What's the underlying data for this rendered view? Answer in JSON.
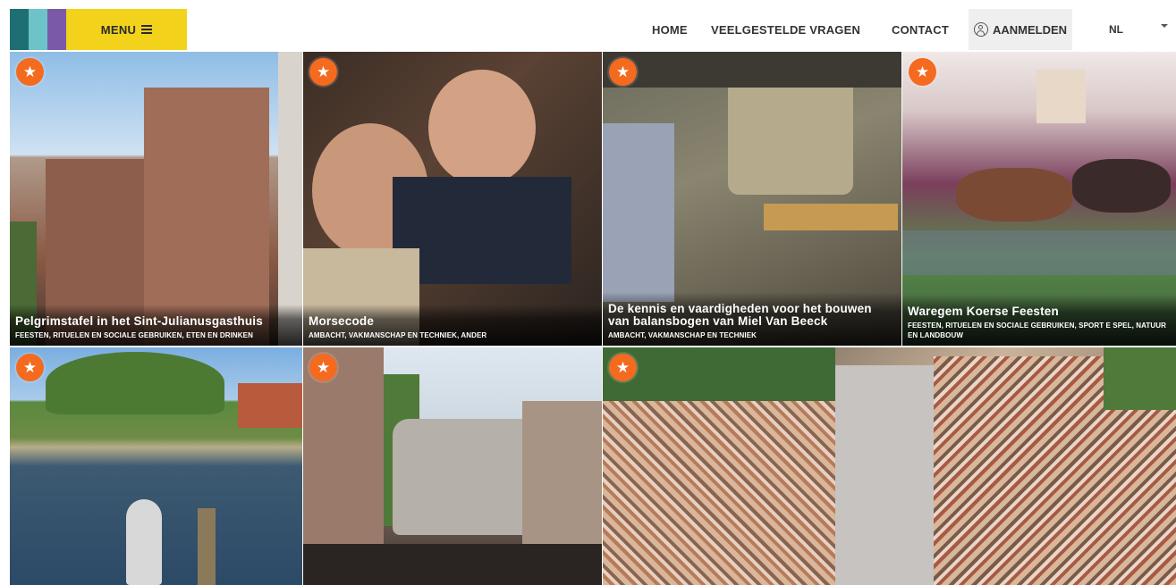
{
  "header": {
    "brand_colors": [
      "#1e6f74",
      "#6cc4c8",
      "#7a5aa8"
    ],
    "menu_label": "MENU",
    "menu_bg": "#f2d21b",
    "nav": [
      "HOME",
      "VEELGESTELDE VRAGEN",
      "CONTACT"
    ],
    "login_label": "AANMELDEN",
    "language": "NL",
    "icons": {
      "menu": "hamburger-icon",
      "login": "user-icon",
      "language": "chevron-down-icon"
    }
  },
  "accent_color": "#f46a1f",
  "tiles": [
    {
      "title": "Pelgrimstafel in het Sint-Julianusgasthuis",
      "categories": "FEESTEN, RITUELEN EN SOCIALE GEBRUIKEN, ETEN EN DRINKEN"
    },
    {
      "title": "Morsecode",
      "categories": "AMBACHT, VAKMANSCHAP EN TECHNIEK, ANDER"
    },
    {
      "title": "De kennis en vaardigheden voor het bouwen van balansbogen van Miel Van Beeck",
      "categories": "AMBACHT, VAKMANSCHAP EN TECHNIEK"
    },
    {
      "title": "Waregem Koerse Feesten",
      "categories": "FEESTEN, RITUELEN EN SOCIALE GEBRUIKEN, SPORT E SPEL, NATUUR EN LANDBOUW"
    },
    {
      "title": "",
      "categories": ""
    },
    {
      "title": "",
      "categories": ""
    },
    {
      "title": "",
      "categories": ""
    }
  ],
  "favorite_icon": "star-icon"
}
